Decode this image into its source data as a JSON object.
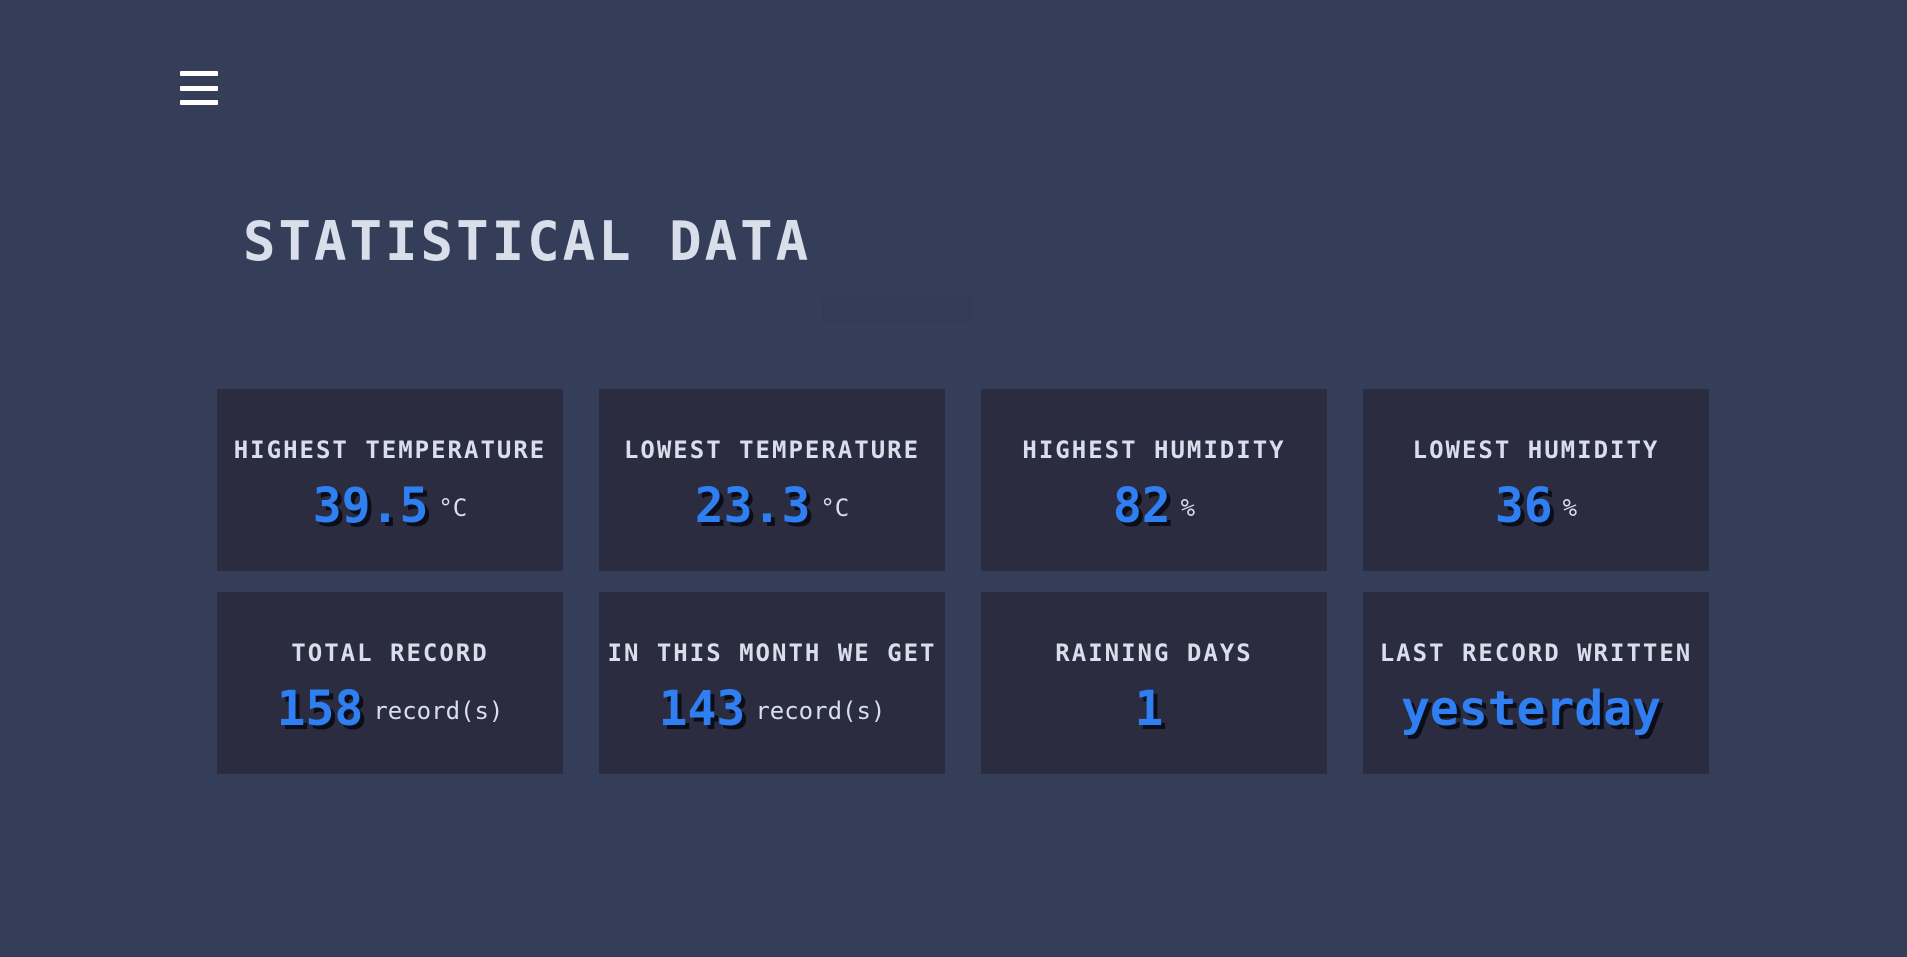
{
  "header": {
    "menu_icon": "hamburger-menu-icon"
  },
  "page": {
    "title": "STATISTICAL DATA"
  },
  "stats": [
    {
      "label": "HIGHEST TEMPERATURE",
      "value": "39.5",
      "unit": "°C"
    },
    {
      "label": "LOWEST TEMPERATURE",
      "value": "23.3",
      "unit": "°C"
    },
    {
      "label": "HIGHEST HUMIDITY",
      "value": "82",
      "unit": "%"
    },
    {
      "label": "LOWEST HUMIDITY",
      "value": "36",
      "unit": "%"
    },
    {
      "label": "TOTAL RECORD",
      "value": "158",
      "unit": "record(s)"
    },
    {
      "label": "IN THIS MONTH WE GET",
      "value": "143",
      "unit": "record(s)"
    },
    {
      "label": "RAINING DAYS",
      "value": "1",
      "unit": ""
    },
    {
      "label": "LAST RECORD WRITTEN",
      "value": "yesterday",
      "unit": ""
    }
  ],
  "colors": {
    "background": "#353e59",
    "card": "#2b2c3f",
    "accent": "#2f7ff2",
    "text": "#d8deea"
  }
}
